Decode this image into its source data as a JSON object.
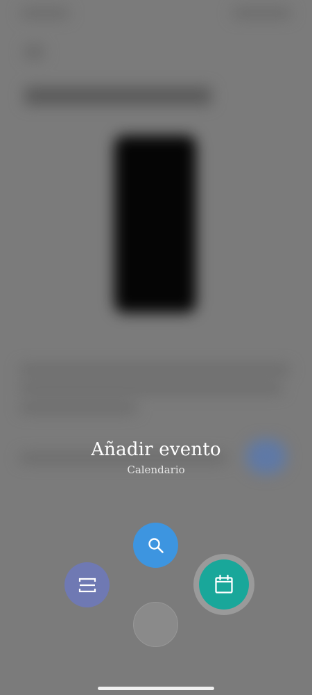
{
  "overlay": {
    "title": "Añadir evento",
    "subtitle": "Calendario"
  },
  "actions": [
    {
      "name": "search",
      "icon": "search-icon",
      "color": "#3d95e0"
    },
    {
      "name": "scan",
      "icon": "scan-icon",
      "color": "#6f79b3"
    },
    {
      "name": "add-event",
      "icon": "calendar-icon",
      "color": "#19a79a",
      "selected": true
    },
    {
      "name": "empty-slot",
      "icon": "",
      "color": "#8a8a8a"
    }
  ],
  "colors": {
    "scrim": "#7b7b7b",
    "blurred_accent": "#5f79a6"
  }
}
